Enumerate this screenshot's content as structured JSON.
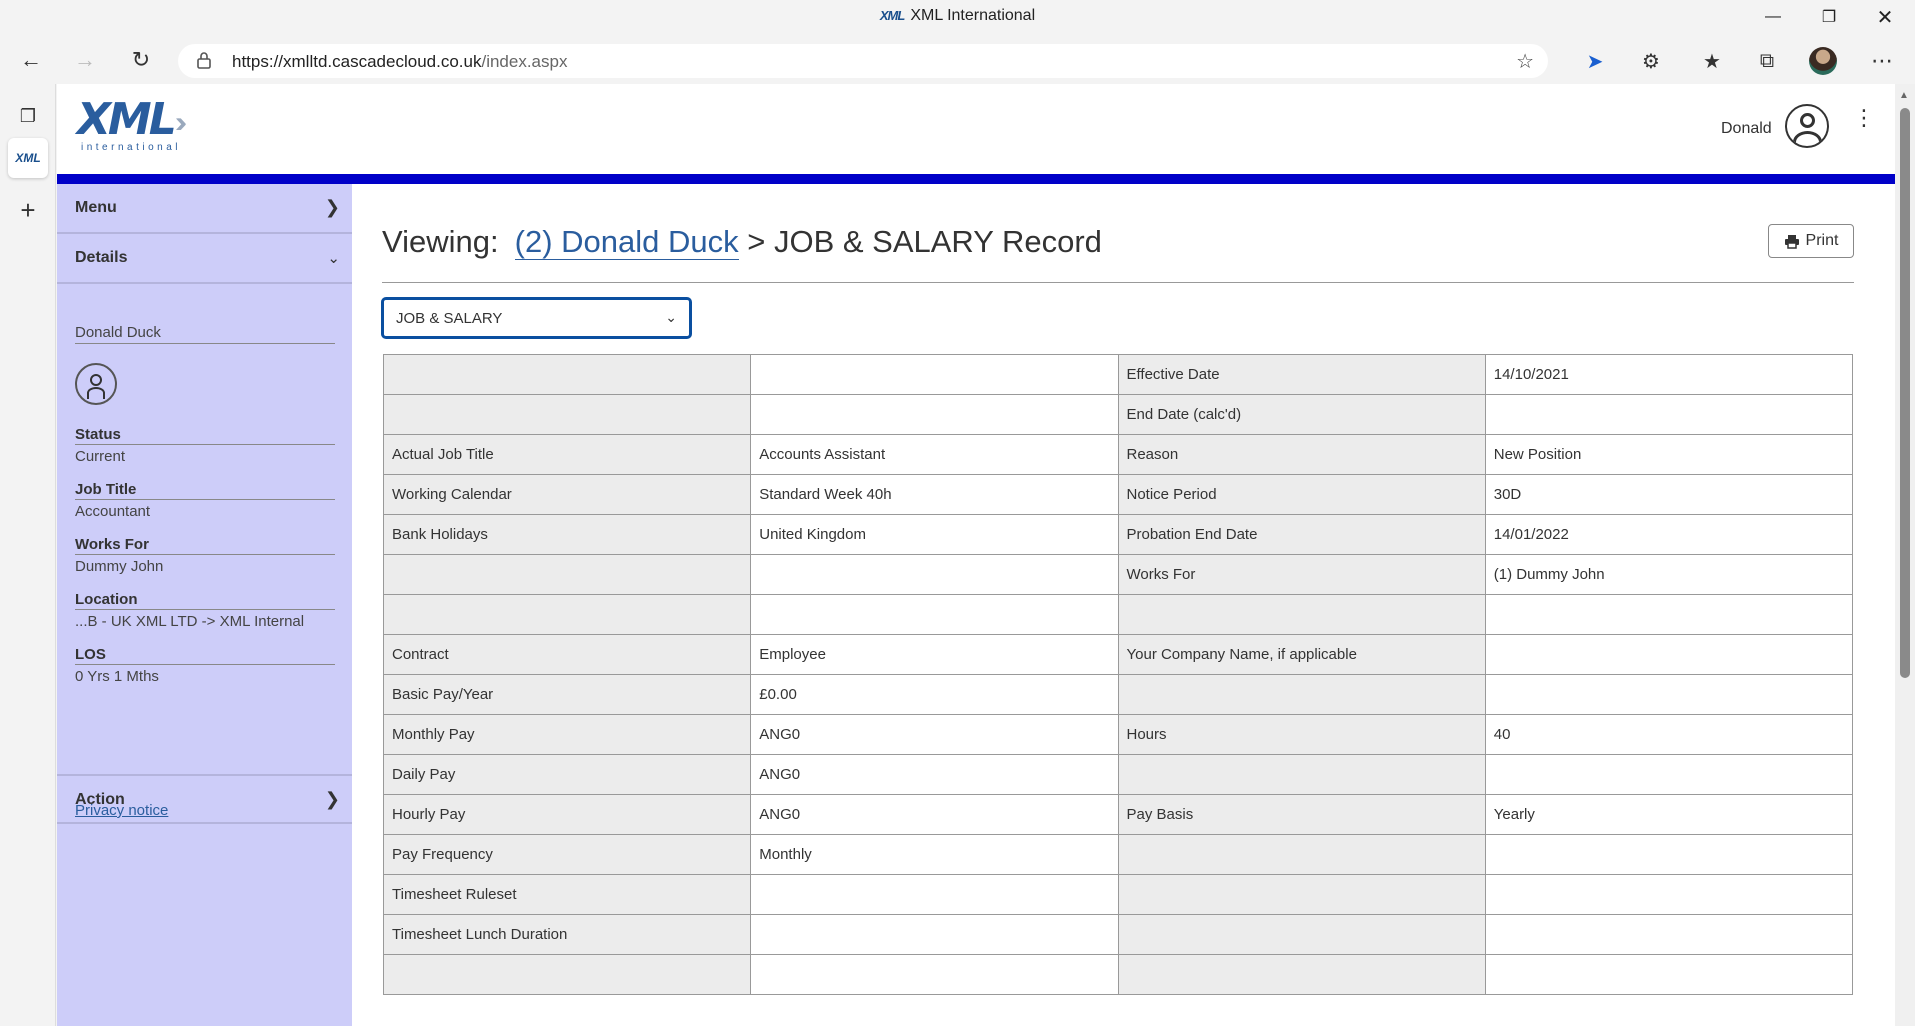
{
  "browser": {
    "window_title": "XML International",
    "url_host": "https://xmlltd.cascadecloud.co.uk",
    "url_path": "/index.aspx",
    "mini_logo": "XML",
    "vtab_logo": "XML"
  },
  "header": {
    "logo_text": "XML",
    "logo_sub": "international",
    "user_name": "Donald"
  },
  "sidebar": {
    "menu_label": "Menu",
    "details_label": "Details",
    "person_name": "Donald Duck",
    "fields": [
      {
        "key": "Status",
        "value": "Current"
      },
      {
        "key": "Job Title",
        "value": "Accountant"
      },
      {
        "key": "Works For",
        "value": "Dummy John"
      },
      {
        "key": "Location",
        "value": "...B - UK XML LTD -> XML Internal"
      },
      {
        "key": "LOS",
        "value": "0 Yrs 1 Mths"
      }
    ],
    "action_label": "Action",
    "privacy_link": "Privacy notice"
  },
  "main": {
    "viewing_prefix": "Viewing:",
    "viewing_person": "(2) Donald Duck",
    "viewing_suffix": "> JOB & SALARY Record",
    "print_label": "Print",
    "record_select": "JOB & SALARY"
  },
  "table": {
    "rows": [
      [
        "",
        "",
        "Effective Date",
        "14/10/2021"
      ],
      [
        "",
        "",
        "End Date (calc'd)",
        ""
      ],
      [
        "Actual Job Title",
        "Accounts Assistant",
        "Reason",
        "New Position"
      ],
      [
        "Working Calendar",
        "Standard Week 40h",
        "Notice Period",
        "30D"
      ],
      [
        "Bank Holidays",
        "United Kingdom",
        "Probation End Date",
        "14/01/2022"
      ],
      [
        "",
        "",
        "Works For",
        "(1) Dummy John"
      ],
      [
        "",
        "",
        "",
        ""
      ],
      [
        "Contract",
        "Employee",
        "Your Company Name, if applicable",
        ""
      ],
      [
        "Basic Pay/Year",
        "£0.00",
        "",
        ""
      ],
      [
        "Monthly Pay",
        "ANG0",
        "Hours",
        "40"
      ],
      [
        "Daily Pay",
        "ANG0",
        "",
        ""
      ],
      [
        "Hourly Pay",
        "ANG0",
        "Pay Basis",
        "Yearly"
      ],
      [
        "Pay Frequency",
        "Monthly",
        "",
        ""
      ],
      [
        "Timesheet Ruleset",
        "",
        "",
        ""
      ],
      [
        "Timesheet Lunch Duration",
        "",
        "",
        ""
      ],
      [
        "",
        "",
        "",
        ""
      ]
    ]
  }
}
